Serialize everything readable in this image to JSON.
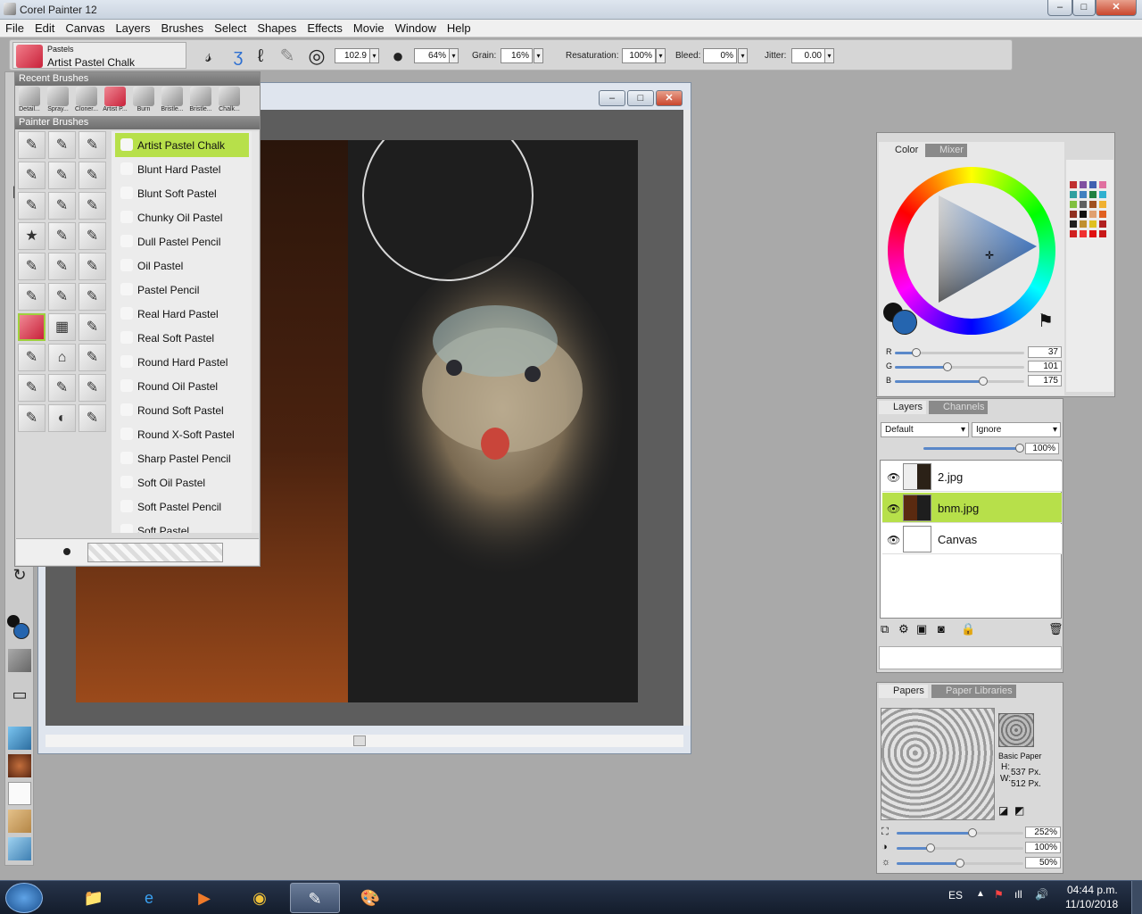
{
  "window": {
    "title": "Corel Painter 12",
    "minimize": "–",
    "maximize": "□",
    "close": "✕"
  },
  "menu": [
    "File",
    "Edit",
    "Canvas",
    "Layers",
    "Brushes",
    "Select",
    "Shapes",
    "Effects",
    "Movie",
    "Window",
    "Help"
  ],
  "brush_selector": {
    "category": "Pastels",
    "variant": "Artist Pastel Chalk"
  },
  "property_bar": {
    "size": "102.9",
    "opacity": "64%",
    "grain_label": "Grain:",
    "grain": "16%",
    "resaturation_label": "Resaturation:",
    "resaturation": "100%",
    "bleed_label": "Bleed:",
    "bleed": "0%",
    "jitter_label": "Jitter:",
    "jitter": "0.00"
  },
  "brush_panel": {
    "recent_title": "Recent Brushes",
    "recent": [
      "Detail...",
      "Spray...",
      "Cloner...",
      "Artist P...",
      "Burn",
      "Bristle...",
      "Bristle...",
      "Chalk..."
    ],
    "library_title": "Painter Brushes",
    "variants": [
      "Artist Pastel Chalk",
      "Blunt Hard Pastel",
      "Blunt Soft Pastel",
      "Chunky Oil Pastel",
      "Dull Pastel Pencil",
      "Oil Pastel",
      "Pastel Pencil",
      "Real Hard Pastel",
      "Real Soft Pastel",
      "Round Hard Pastel",
      "Round Oil Pastel",
      "Round Soft Pastel",
      "Round X-Soft Pastel",
      "Sharp Pastel Pencil",
      "Soft Oil Pastel",
      "Soft Pastel Pencil",
      "Soft Pastel"
    ],
    "selected": "Artist Pastel Chalk"
  },
  "color_panel": {
    "tabs": [
      "Color",
      "Mixer"
    ],
    "r_label": "R",
    "g_label": "G",
    "b_label": "B",
    "r": "37",
    "g": "101",
    "b": "175",
    "main_color": "#2565af"
  },
  "layers_panel": {
    "tabs": [
      "Layers",
      "Channels"
    ],
    "composite_method": "Default",
    "composite_depth": "Ignore",
    "opacity": "100%",
    "layers": [
      {
        "name": "2.jpg",
        "selected": false
      },
      {
        "name": "bnm.jpg",
        "selected": true
      },
      {
        "name": "Canvas",
        "selected": false
      }
    ]
  },
  "papers_panel": {
    "tabs": [
      "Papers",
      "Paper Libraries"
    ],
    "paper_name": "Basic Paper",
    "height_label": "H:",
    "height": "537 Px.",
    "width_label": "W:",
    "width": "512 Px.",
    "scale": "252%",
    "contrast": "100%",
    "brightness": "50%"
  },
  "taskbar": {
    "language": "ES",
    "time": "04:44 p.m.",
    "date": "11/10/2018"
  }
}
